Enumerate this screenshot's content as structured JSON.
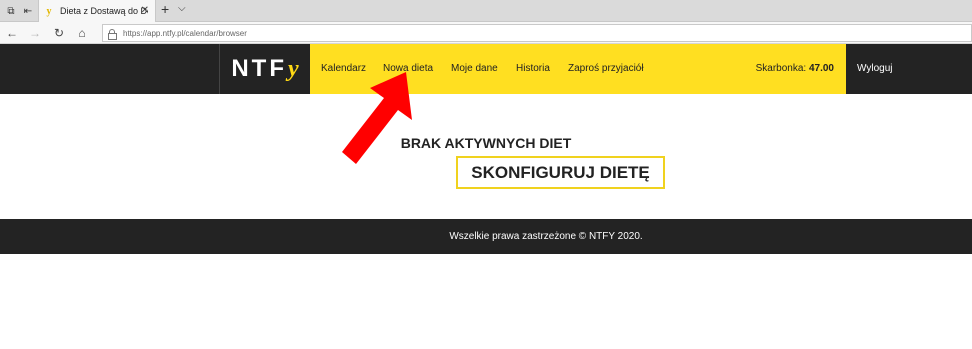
{
  "browser": {
    "tab_title": "Dieta z Dostawą do Dom",
    "url": "https://app.ntfy.pl/calendar/browser"
  },
  "header": {
    "logo_text": "NTF",
    "logo_accent": "y",
    "nav": [
      "Kalendarz",
      "Nowa dieta",
      "Moje dane",
      "Historia",
      "Zaproś przyjaciół"
    ],
    "balance_label": "Skarbonka:",
    "balance_value": "47.00",
    "logout_label": "Wyloguj"
  },
  "main": {
    "empty_heading": "BRAK AKTYWNYCH DIET",
    "configure_label": "SKONFIGURUJ DIETĘ"
  },
  "footer": {
    "copyright": "Wszelkie prawa zastrzeżone © NTFY 2020."
  },
  "colors": {
    "accent_yellow": "#ffdf21",
    "dark": "#232323",
    "annotation_arrow": "#ff0000"
  }
}
